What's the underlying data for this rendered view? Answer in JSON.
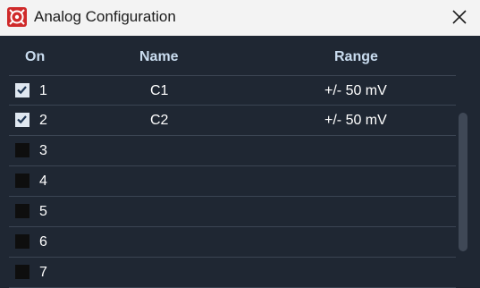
{
  "window": {
    "title": "Analog Configuration"
  },
  "icons": {
    "app": "app-logo-icon",
    "close": "close-icon",
    "check": "checkmark-icon"
  },
  "colors": {
    "titlebar": "#f3f3f3",
    "background": "#1f2733",
    "header_text": "#c9dcef",
    "row_divider": "#3b4553",
    "app_icon": "#cf2a2a"
  },
  "table": {
    "columns": [
      "On",
      "Name",
      "Range"
    ],
    "rows": [
      {
        "on": true,
        "number": "1",
        "name": "C1",
        "range": "+/- 50 mV"
      },
      {
        "on": true,
        "number": "2",
        "name": "C2",
        "range": "+/- 50 mV"
      },
      {
        "on": false,
        "number": "3",
        "name": "",
        "range": ""
      },
      {
        "on": false,
        "number": "4",
        "name": "",
        "range": ""
      },
      {
        "on": false,
        "number": "5",
        "name": "",
        "range": ""
      },
      {
        "on": false,
        "number": "6",
        "name": "",
        "range": ""
      },
      {
        "on": false,
        "number": "7",
        "name": "",
        "range": ""
      }
    ]
  }
}
